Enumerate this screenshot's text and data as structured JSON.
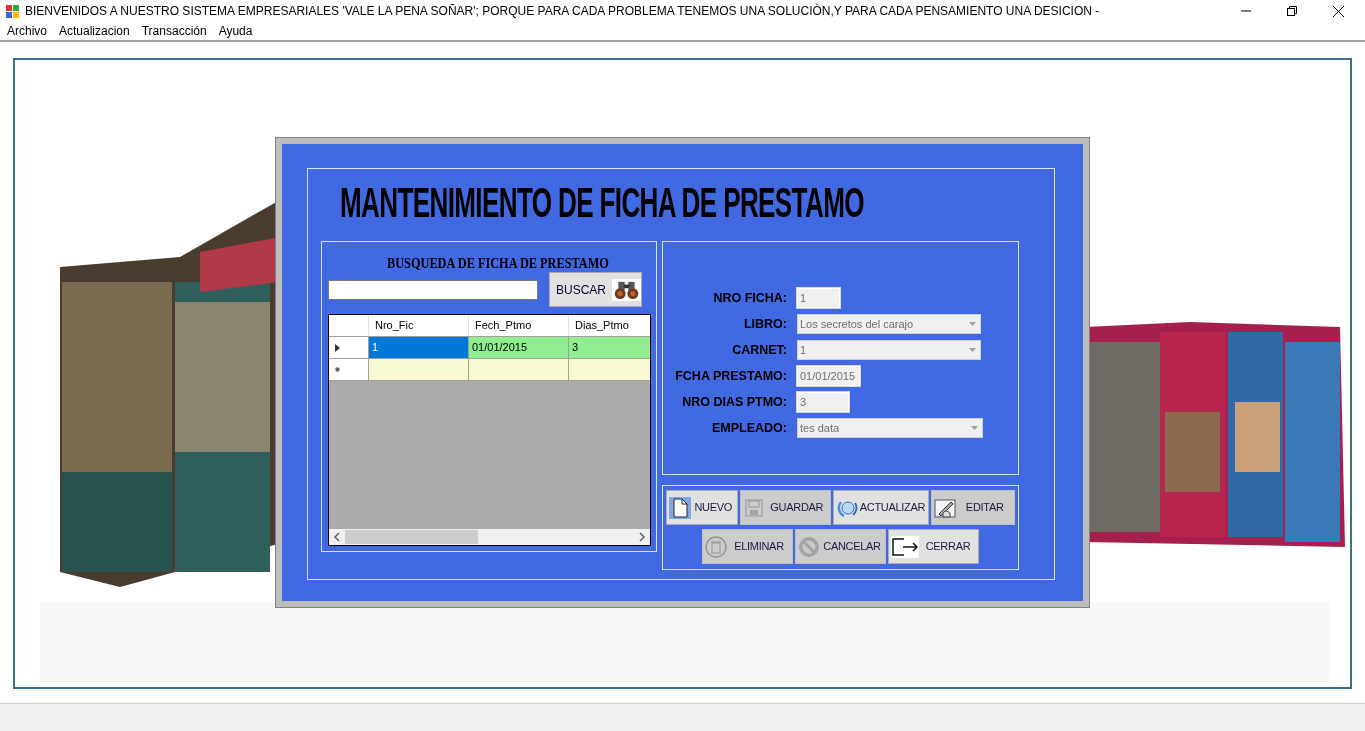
{
  "window": {
    "title": "BIENVENIDOS A NUESTRO SISTEMA EMPRESARIALES 'VALE LA PENA SOÑAR'; PORQUE PARA CADA PROBLEMA TENEMOS UNA SOLUCIÒN,Y PARA CADA PENSAMIENTO UNA DESICION  -"
  },
  "menu": [
    "Archivo",
    "Actualizacion",
    "Transacción",
    "Ayuda"
  ],
  "form": {
    "title": "MANTENIMIENTO DE FICHA DE PRESTAMO",
    "search": {
      "heading": "BUSQUEDA DE FICHA DE PRESTAMO",
      "button": "BUSCAR"
    },
    "grid": {
      "columns": [
        "Nro_Fic",
        "Fech_Ptmo",
        "Dias_Ptmo"
      ],
      "rows": [
        {
          "kind": "data",
          "selected": true,
          "cells": [
            "1",
            "01/01/2015",
            "3"
          ]
        },
        {
          "kind": "new",
          "selected": false
        }
      ]
    },
    "fields": [
      {
        "label": "NRO FICHA:",
        "value": "1",
        "kind": "text"
      },
      {
        "label": "LIBRO:",
        "value": "Los secretos del carajo",
        "kind": "combo"
      },
      {
        "label": "CARNET:",
        "value": "1",
        "kind": "combo"
      },
      {
        "label": "FCHA PRESTAMO:",
        "value": "01/01/2015",
        "kind": "text"
      },
      {
        "label": "NRO DIAS PTMO:",
        "value": "3",
        "kind": "text"
      },
      {
        "label": "EMPLEADO:",
        "value": "tes data",
        "kind": "combo"
      }
    ],
    "button_rows": [
      [
        {
          "label": "NUEVO",
          "kind": "new",
          "disabled": false
        },
        {
          "label": "GUARDAR",
          "kind": "save",
          "disabled": true
        },
        {
          "label": "ACTUALIZAR",
          "kind": "refresh",
          "disabled": false
        },
        {
          "label": "EDITAR",
          "kind": "edit",
          "disabled": true
        }
      ],
      [
        {
          "label": "ELIMINAR",
          "kind": "delete",
          "disabled": true
        },
        {
          "label": "CANCELAR",
          "kind": "cancel",
          "disabled": true
        },
        {
          "label": "CERRAR",
          "kind": "exit",
          "disabled": false
        }
      ]
    ]
  }
}
